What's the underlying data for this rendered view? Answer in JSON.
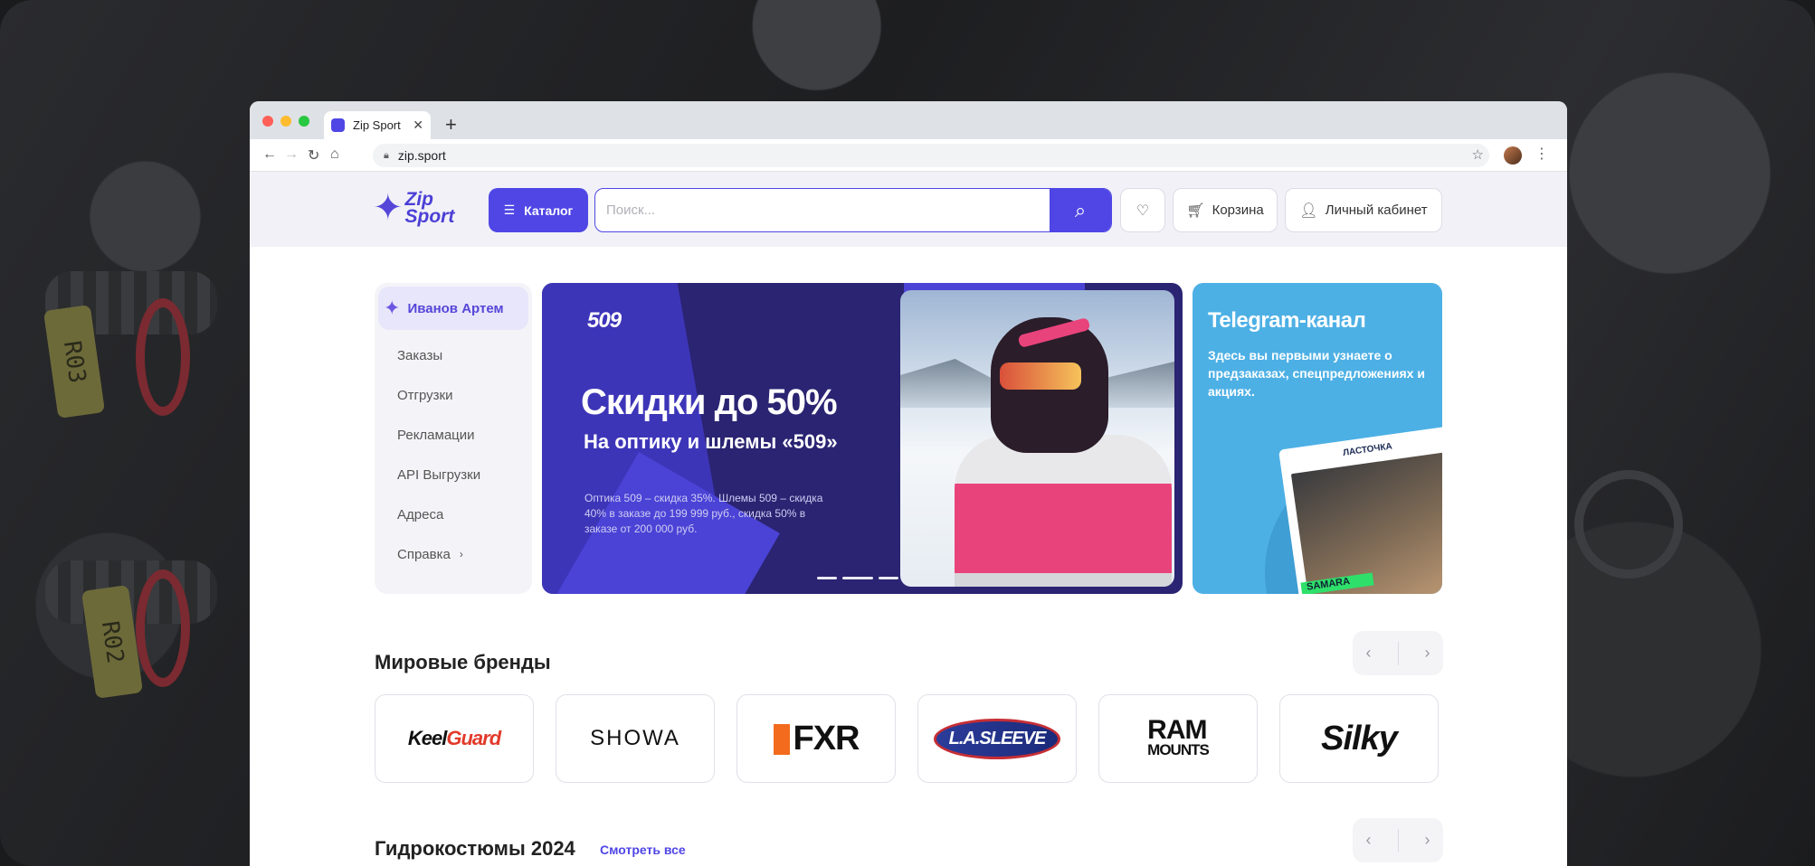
{
  "browser": {
    "tab_title": "Zip Sport",
    "tab_close": "✕",
    "new_tab": "+",
    "url": "zip.sport",
    "traffic_lights": [
      "#ff5f57",
      "#febc2e",
      "#28c840"
    ]
  },
  "header": {
    "logo_line1": "Zip",
    "logo_line2": "Sport",
    "catalog_label": "Каталог",
    "search_placeholder": "Поиск...",
    "cart_label": "Корзина",
    "account_label": "Личный кабинет",
    "accent_color": "#4f46e5"
  },
  "sidebar": {
    "user_name": "Иванов Артем",
    "items": [
      {
        "label": "Заказы"
      },
      {
        "label": "Отгрузки"
      },
      {
        "label": "Рекламации"
      },
      {
        "label": "API Выгрузки"
      },
      {
        "label": "Адреса"
      },
      {
        "label": "Справка"
      }
    ]
  },
  "banner": {
    "brand_logo": "509",
    "title": "Скидки до 50%",
    "subtitle": "На оптику и шлемы «509»",
    "description": "Оптика 509 – скидка 35%. Шлемы 509 – скидка 40% в заказе до 199 999 руб., скидка 50% в заказе от 200 000 руб.",
    "slides": 3
  },
  "telegram": {
    "title": "Telegram-канал",
    "description": "Здесь вы первыми узнаете о предзаказах, спецпредложениях и акциях.",
    "card_label": "ЛАСТОЧКА",
    "card_tag": "SAMARA"
  },
  "sections": {
    "brands_title": "Мировые бренды",
    "wetsuits_title": "Гидрокостюмы 2024",
    "see_all": "Смотреть все"
  },
  "brands": [
    {
      "part1": "Keel",
      "part2": "Guard"
    },
    {
      "name": "SHOWA"
    },
    {
      "name": "FXR"
    },
    {
      "name": "L.A.SLEEVE"
    },
    {
      "name": "RAM",
      "sub": "MOUNTS"
    },
    {
      "name": "Silky"
    }
  ]
}
